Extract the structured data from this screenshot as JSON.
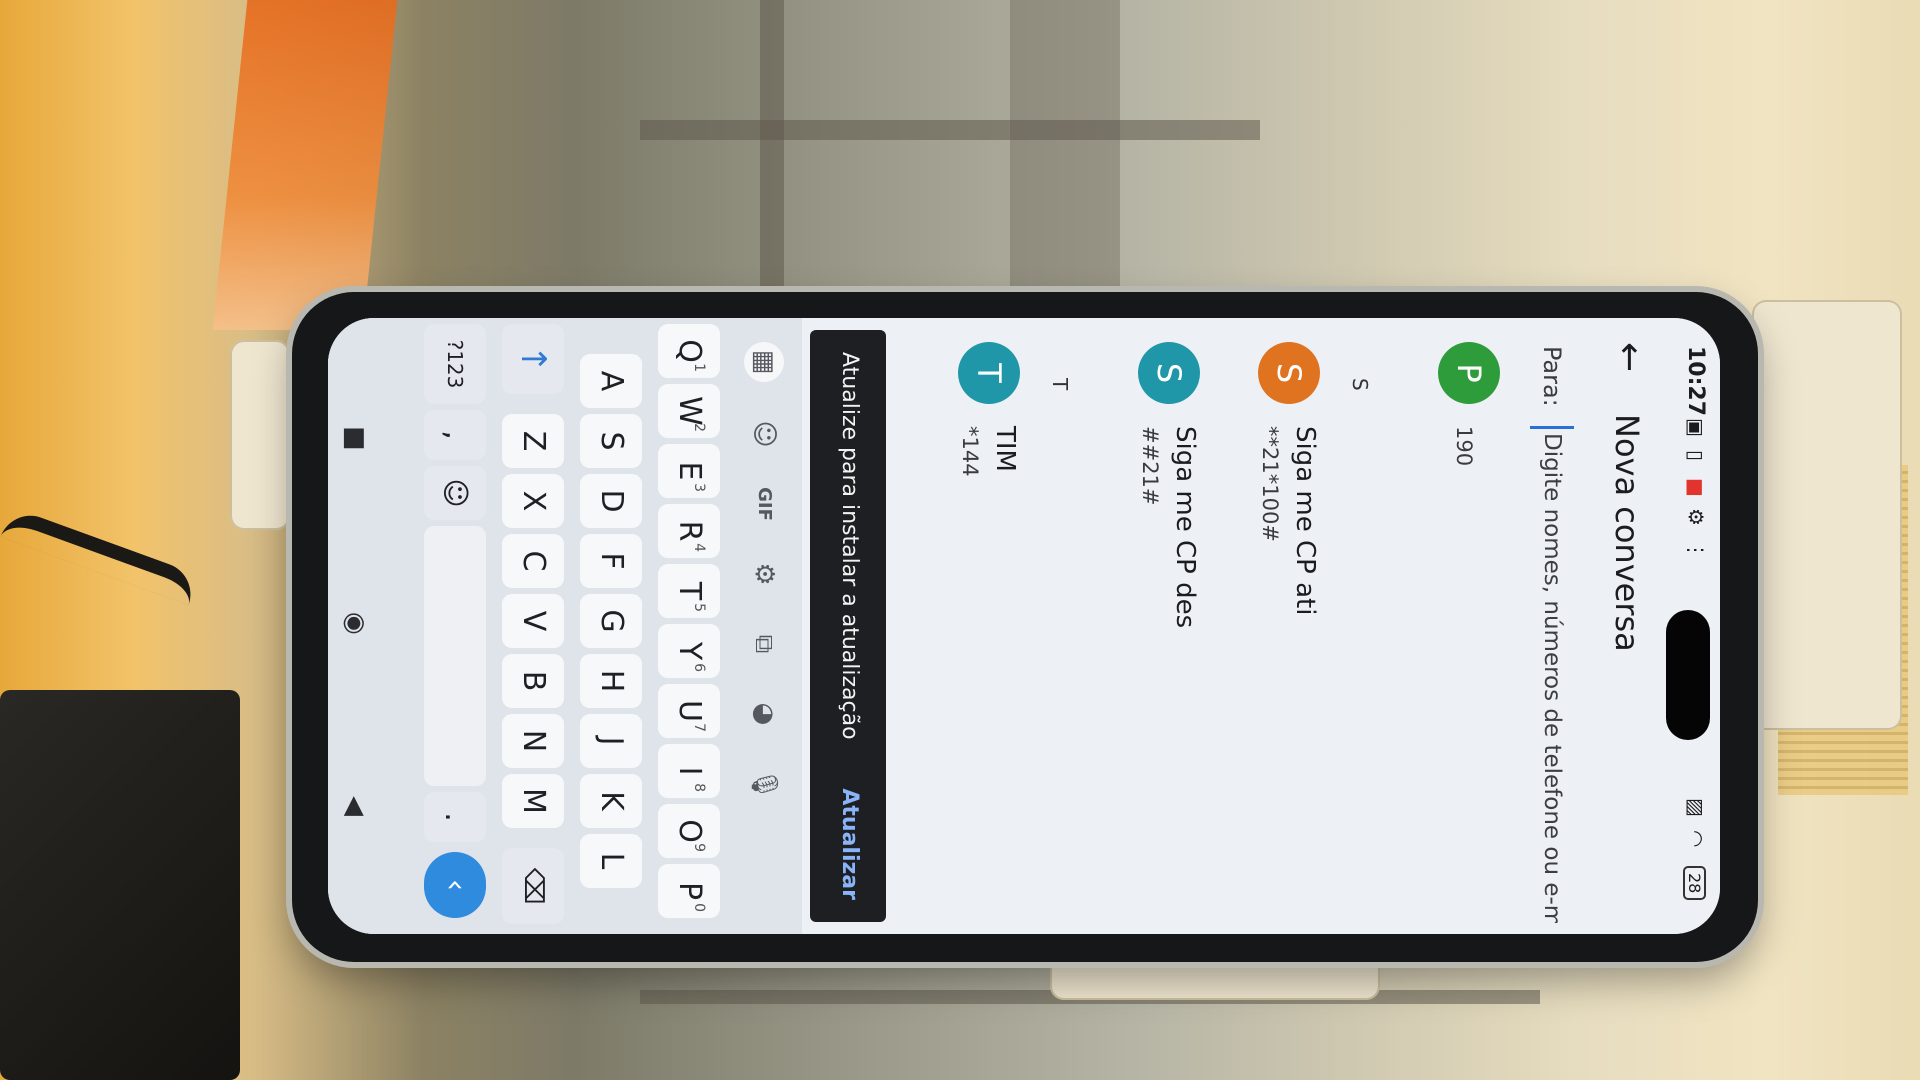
{
  "status_bar": {
    "time": "10:27",
    "battery": "28"
  },
  "header": {
    "title": "Nova conversa"
  },
  "to_field": {
    "label": "Para:",
    "placeholder": "Digite nomes, números de telefone ou e-mails"
  },
  "contacts": [
    {
      "avatar": "P",
      "avatar_color": "#2e9c3a",
      "name": "",
      "sub": "190"
    },
    {
      "section": "S"
    },
    {
      "avatar": "S",
      "avatar_color": "#e07320",
      "name": "Siga me CP ati",
      "sub": "**21*100#"
    },
    {
      "avatar": "S",
      "avatar_color": "#1f97a8",
      "name": "Siga me CP des",
      "sub": "##21#"
    },
    {
      "section": "T"
    },
    {
      "avatar": "T",
      "avatar_color": "#1f97a8",
      "name": "TIM",
      "sub": "*144"
    }
  ],
  "snackbar": {
    "message": "Atualize para instalar a atualização",
    "action": "Atualizar"
  },
  "keyboard": {
    "toolbar": {
      "gif": "GIF"
    },
    "row1": [
      {
        "k": "Q",
        "n": "1"
      },
      {
        "k": "W",
        "n": "2"
      },
      {
        "k": "E",
        "n": "3"
      },
      {
        "k": "R",
        "n": "4"
      },
      {
        "k": "T",
        "n": "5"
      },
      {
        "k": "Y",
        "n": "6"
      },
      {
        "k": "U",
        "n": "7"
      },
      {
        "k": "I",
        "n": "8"
      },
      {
        "k": "O",
        "n": "9"
      },
      {
        "k": "P",
        "n": "0"
      }
    ],
    "row2": [
      "A",
      "S",
      "D",
      "F",
      "G",
      "H",
      "J",
      "K",
      "L"
    ],
    "row3": [
      "Z",
      "X",
      "C",
      "V",
      "B",
      "N",
      "M"
    ],
    "symbols_key": "?123",
    "comma_key": ",",
    "period_key": "."
  }
}
